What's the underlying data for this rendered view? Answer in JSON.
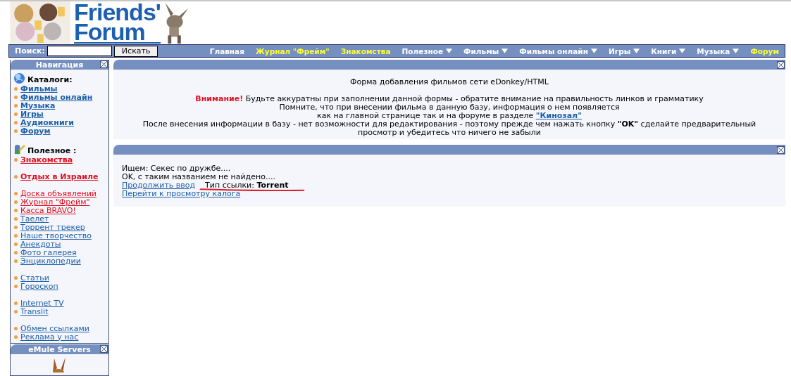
{
  "header": {
    "logo": [
      "Friends'",
      "Forum"
    ]
  },
  "navbar": {
    "search_label": "Поиск:",
    "search_button": "Искать",
    "items": [
      {
        "label": "Главная",
        "highlighted": false,
        "dropdown": false
      },
      {
        "label": "Журнал \"Фрейм\"",
        "highlighted": true,
        "dropdown": false
      },
      {
        "label": "Знакомства",
        "highlighted": true,
        "dropdown": false
      },
      {
        "label": "Полезное",
        "highlighted": false,
        "dropdown": true
      },
      {
        "label": "Фильмы",
        "highlighted": false,
        "dropdown": true
      },
      {
        "label": "Фильмы онлайн",
        "highlighted": false,
        "dropdown": true
      },
      {
        "label": "Игры",
        "highlighted": false,
        "dropdown": true
      },
      {
        "label": "Книги",
        "highlighted": false,
        "dropdown": true
      },
      {
        "label": "Музыка",
        "highlighted": false,
        "dropdown": true
      },
      {
        "label": "Форум",
        "highlighted": true,
        "dropdown": false
      }
    ]
  },
  "sidebar": {
    "title": "Навигация",
    "sections": [
      {
        "heading": "Каталоги:",
        "groups": [
          [
            {
              "label": "Фильмы",
              "kind": "catalog"
            },
            {
              "label": "Фильмы онлайн",
              "kind": "catalog"
            },
            {
              "label": "Музыка",
              "kind": "catalog"
            },
            {
              "label": "Игры",
              "kind": "catalog"
            },
            {
              "label": "Аудиокниги",
              "kind": "catalog"
            },
            {
              "label": "Форум",
              "kind": "catalog"
            }
          ]
        ]
      },
      {
        "heading": "Полезное :",
        "groups": [
          [
            {
              "label": "Знакомства",
              "kind": "featured"
            }
          ],
          [
            {
              "label": "Отдых в Израиле",
              "kind": "featured"
            }
          ],
          [
            {
              "label": "Доска объявлений",
              "kind": "promo"
            },
            {
              "label": "Журнал \"Фрейм\"",
              "kind": "promo"
            },
            {
              "label": "Касса BRAVO!",
              "kind": "promo"
            },
            {
              "label": "Таелет",
              "kind": "link"
            },
            {
              "label": "Торрент трекер",
              "kind": "link"
            },
            {
              "label": "Наше творчество",
              "kind": "link"
            },
            {
              "label": "Анекдоты",
              "kind": "link"
            },
            {
              "label": "Фото галерея",
              "kind": "link"
            },
            {
              "label": "Энциклопедии",
              "kind": "link"
            }
          ],
          [
            {
              "label": "Статьи",
              "kind": "link"
            },
            {
              "label": "Гороскоп",
              "kind": "link"
            }
          ],
          [
            {
              "label": "Internet TV",
              "kind": "link"
            },
            {
              "label": "Translit",
              "kind": "link"
            }
          ],
          [
            {
              "label": "Обмен ссылками",
              "kind": "link"
            },
            {
              "label": "Реклама у нас",
              "kind": "link"
            }
          ]
        ]
      }
    ],
    "box2_title": "eMule Servers"
  },
  "form_panel": {
    "title": "Форма добавления фильмов сети eDonkey/HTML",
    "warning_label": "Внимание!",
    "warning": "Будьте аккуратны при заполнении данной формы - обратите внимание на правильность линков и грамматику",
    "line1": "Помните, что при внесении фильма в данную базу, информация о нем появляется",
    "line2": "как на главной странице так и на форуме в разделе",
    "line2_link": "\"Кинозал\"",
    "line3": "После внесения информации в базу - нет возможности для редактирования - поэтому прежде чем нажать кнопку **\"OK\"** сделайте предварительный просмотр и убедитесь что ничего не забыли"
  },
  "result_panel": {
    "search_line": "Ищем: Секес по дружбе....",
    "status_line": "OK, с таким названием не найдено....",
    "continue_link": "Продолжить ввод",
    "link_type": "Тип ссылки: **Torrent**",
    "link_type_marked": true,
    "catalog_link": "Перейти к просмотру калога"
  }
}
